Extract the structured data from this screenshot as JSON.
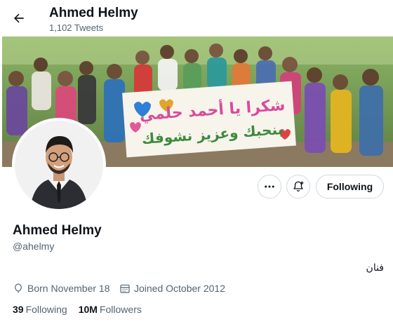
{
  "header": {
    "name": "Ahmed Helmy",
    "tweet_count": "1,102 Tweets",
    "back_icon": "arrow-left-icon"
  },
  "banner": {
    "sign_line1": "شكرا يا أحمد حلمي",
    "sign_line2": "بنحبك وعزيز نشوفك"
  },
  "actions": {
    "more_icon": "ellipsis-icon",
    "notify_icon": "bell-plus-icon",
    "following_label": "Following"
  },
  "profile": {
    "name": "Ahmed Helmy",
    "handle": "@ahelmy",
    "bio": "فنان",
    "born": "Born November 18",
    "joined": "Joined October 2012",
    "following_count": "39",
    "following_label": "Following",
    "followers_count": "10M",
    "followers_label": "Followers"
  },
  "colors": {
    "text_primary": "#0f1419",
    "text_secondary": "#536471",
    "border": "#cfd9de"
  }
}
